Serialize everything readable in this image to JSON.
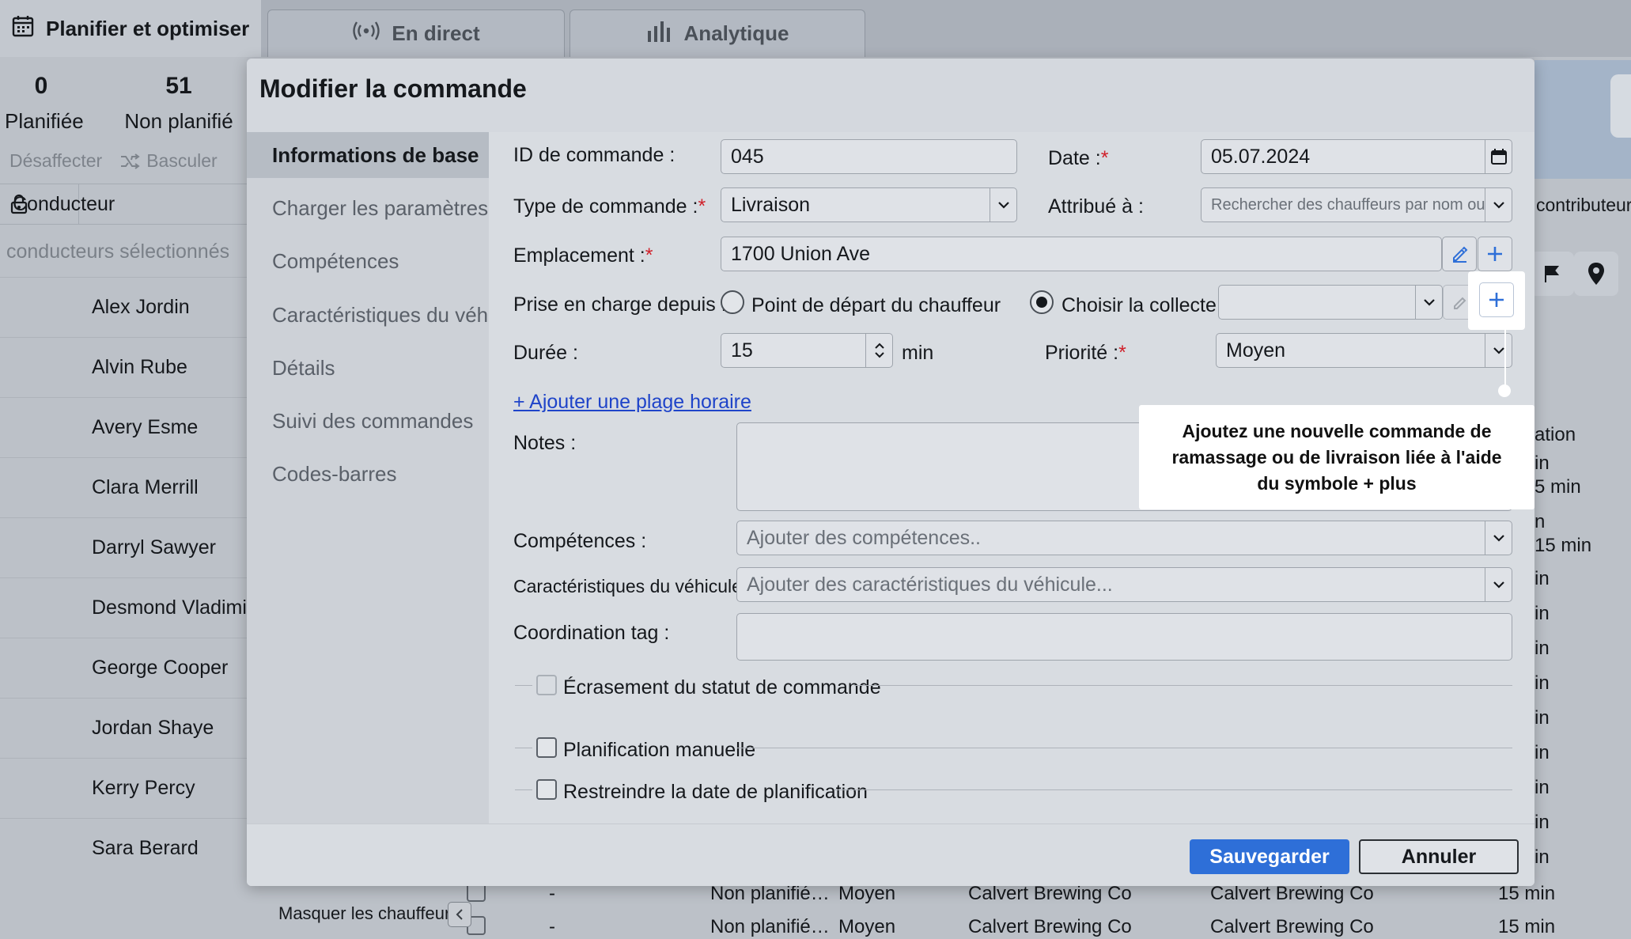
{
  "tabs": [
    {
      "label": "Planifier et optimiser",
      "icon": "calendar-icon"
    },
    {
      "label": "En direct",
      "icon": "broadcast-icon"
    },
    {
      "label": "Analytique",
      "icon": "bar-chart-icon"
    }
  ],
  "stats": {
    "planned": {
      "value": "0",
      "label": "Planifiée"
    },
    "unplanned": {
      "value": "51",
      "label": "Non planifié"
    }
  },
  "actions": {
    "unassign": "Désaffecter",
    "toggle": "Basculer"
  },
  "drivers_table": {
    "column": "Conducteur",
    "selected_label": "conducteurs sélectionnés",
    "drivers": [
      "Alex Jordin",
      "Alvin Rube",
      "Avery Esme",
      "Clara Merrill",
      "Darryl Sawyer",
      "Desmond Vladimi",
      "George Cooper",
      "Jordan Shaye",
      "Kerry Percy",
      "Sara Berard"
    ],
    "hide_label": "Masquer les chauffeurs"
  },
  "right_panel": {
    "contributors": "contributeurs",
    "column_fragment": "ation",
    "cells": [
      "in",
      "5 min",
      "n",
      "15 min",
      "in",
      "in",
      "in",
      "in",
      "in",
      "in",
      "in",
      "in",
      "in"
    ]
  },
  "bottom_rows": [
    {
      "dash": "-",
      "status": "Non planifié…",
      "priority": "Moyen",
      "pickup": "Calvert Brewing Co",
      "delivery": "Calvert Brewing Co",
      "duration": "15 min"
    },
    {
      "dash": "-",
      "status": "Non planifié…",
      "priority": "Moyen",
      "pickup": "Calvert Brewing Co",
      "delivery": "Calvert Brewing Co",
      "duration": "15 min"
    }
  ],
  "modal": {
    "title": "Modifier la commande",
    "nav": [
      "Informations de base",
      "Charger les paramètres",
      "Compétences",
      "Caractéristiques du véhicule",
      "Détails",
      "Suivi des commandes",
      "Codes-barres"
    ],
    "order_id": {
      "label": "ID de commande :",
      "value": "045"
    },
    "date": {
      "label": "Date :",
      "required": "*",
      "value": "05.07.2024"
    },
    "order_type": {
      "label": "Type de commande :",
      "required": "*",
      "value": "Livraison"
    },
    "assigned_to": {
      "label": "Attribué à :",
      "placeholder": "Rechercher des chauffeurs par nom ou par se"
    },
    "location": {
      "label": "Emplacement :",
      "required": "*",
      "value": "1700 Union Ave"
    },
    "pickup_from": {
      "label": "Prise en charge depuis :",
      "option_driver": "Point de départ du chauffeur",
      "option_choose": "Choisir la collecte :"
    },
    "duration": {
      "label": "Durée :",
      "value": "15",
      "unit": "min"
    },
    "priority": {
      "label": "Priorité :",
      "required": "*",
      "value": "Moyen"
    },
    "add_slot": "+ Ajouter une plage horaire",
    "notes": {
      "label": "Notes :"
    },
    "skills": {
      "label": "Compétences :",
      "placeholder": "Ajouter des compétences.."
    },
    "vehicle": {
      "label": "Caractéristiques du véhicule :",
      "placeholder": "Ajouter des caractéristiques du véhicule..."
    },
    "coordination": {
      "label": "Coordination tag :"
    },
    "overwrite_status": "Écrasement du statut de commande",
    "manual_planning": "Planification manuelle",
    "restrict_date": "Restreindre la date de planification",
    "save": "Sauvegarder",
    "cancel": "Annuler"
  },
  "tooltip": "Ajoutez une nouvelle commande de ramassage ou de livraison liée à l'aide du symbole + plus",
  "colors": {
    "accent": "#2e6fd8",
    "required": "#d0202a",
    "link": "#1f44c9"
  }
}
